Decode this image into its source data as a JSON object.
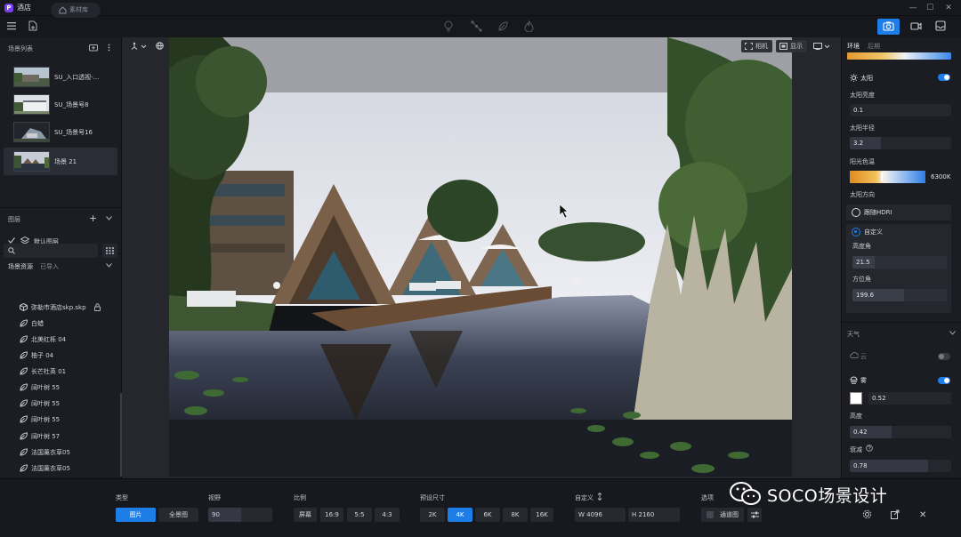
{
  "app": {
    "title": "酒店",
    "logo_glyph": "P"
  },
  "toolbar": {
    "material_library": "素材库"
  },
  "scene_list": {
    "header": "场景列表",
    "items": [
      {
        "name": "SU_入口透视-...",
        "active": false
      },
      {
        "name": "SU_场景号8",
        "active": false
      },
      {
        "name": "SU_场景号16",
        "active": false
      },
      {
        "name": "场景 21",
        "active": true
      }
    ]
  },
  "layers": {
    "header": "图层",
    "items": [
      "默认图层"
    ]
  },
  "assets": {
    "tab_scene_assets": "场景资源",
    "tab_imported": "已导入",
    "items": [
      {
        "name": "弥勒市酒店skp.skp",
        "kind": "model"
      },
      {
        "name": "白蜡",
        "kind": "plant"
      },
      {
        "name": "北美红栎 04",
        "kind": "plant"
      },
      {
        "name": "柚子 04",
        "kind": "plant"
      },
      {
        "name": "长芒杜英 01",
        "kind": "plant"
      },
      {
        "name": "阔叶树 55",
        "kind": "plant"
      },
      {
        "name": "阔叶树 55",
        "kind": "plant"
      },
      {
        "name": "阔叶树 55",
        "kind": "plant"
      },
      {
        "name": "阔叶树 57",
        "kind": "plant"
      },
      {
        "name": "法国薰衣草05",
        "kind": "plant"
      },
      {
        "name": "法国薰衣草05",
        "kind": "plant"
      }
    ]
  },
  "viewport": {
    "camera_label": "相机",
    "display_label": "显示"
  },
  "right_panel": {
    "tab_environment": "环境",
    "tab_post": "后期",
    "sun": {
      "title": "太阳",
      "enabled": true,
      "brightness_label": "太阳亮度",
      "brightness": "0.1",
      "radius_label": "太阳半径",
      "radius": "3.2",
      "color_temp_label": "阳光色温",
      "color_temp": "6300K",
      "direction_label": "太阳方向",
      "option_follow_hdri": "跟随HDRI",
      "option_custom": "自定义",
      "selected": "自定义",
      "altitude_label": "高度角",
      "altitude": "21.5",
      "azimuth_label": "方位角",
      "azimuth": "199.6"
    },
    "weather": {
      "title": "天气",
      "cloud_label": "云",
      "cloud_enabled": false,
      "fog_label": "雾",
      "fog_enabled": true,
      "fog_value": "0.52",
      "fog_color": "#ffffff",
      "height_label": "高度",
      "height": "0.42",
      "decay_label": "衰减",
      "decay": "0.78"
    }
  },
  "bottom_bar": {
    "type_label": "类型",
    "type_image": "图片",
    "type_panorama": "全景图",
    "type_selected": "图片",
    "fov_label": "视野",
    "fov": "90",
    "ratio_label": "比例",
    "ratios": [
      "屏幕",
      "16:9",
      "5:5",
      "4:3"
    ],
    "preset_label": "预设尺寸",
    "presets": [
      "2K",
      "4K",
      "6K",
      "8K",
      "16K"
    ],
    "preset_selected": "4K",
    "custom_label": "自定义",
    "width": "W  4096",
    "height": "H  2160",
    "options_label": "选项",
    "channel_label": "通道图"
  },
  "watermark": {
    "text": "SOCO场景设计"
  },
  "colors": {
    "accent": "#1e7ee8",
    "panel": "#1b1d22",
    "background": "#16181d"
  }
}
